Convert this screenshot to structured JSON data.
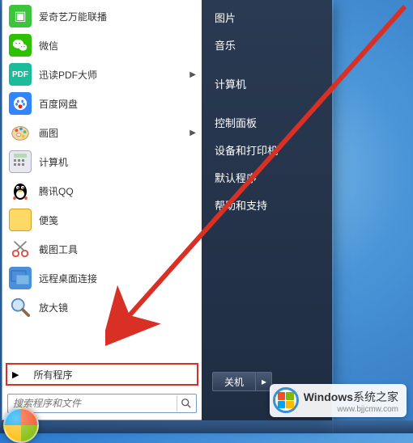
{
  "programs": [
    {
      "label": "爱奇艺万能联播",
      "icon": "iqiyi",
      "has_submenu": false
    },
    {
      "label": "微信",
      "icon": "wechat",
      "has_submenu": false
    },
    {
      "label": "迅读PDF大师",
      "icon": "pdf",
      "has_submenu": true
    },
    {
      "label": "百度网盘",
      "icon": "baidu",
      "has_submenu": false
    },
    {
      "label": "画图",
      "icon": "paint",
      "has_submenu": true
    },
    {
      "label": "计算机",
      "icon": "calc",
      "has_submenu": false
    },
    {
      "label": "腾讯QQ",
      "icon": "qq",
      "has_submenu": false
    },
    {
      "label": "便笺",
      "icon": "note",
      "has_submenu": false
    },
    {
      "label": "截图工具",
      "icon": "snip",
      "has_submenu": false
    },
    {
      "label": "远程桌面连接",
      "icon": "rdp",
      "has_submenu": false
    },
    {
      "label": "放大镜",
      "icon": "mag",
      "has_submenu": false
    }
  ],
  "all_programs_label": "所有程序",
  "search_placeholder": "搜索程序和文件",
  "right_items": [
    "图片",
    "音乐",
    "计算机",
    "控制面板",
    "设备和打印机",
    "默认程序",
    "帮助和支持"
  ],
  "shutdown_label": "关机",
  "watermark": {
    "title_prefix": "Windows",
    "title_suffix": "系统之家",
    "url": "www.bjjcmw.com"
  },
  "colors": {
    "highlight_border": "#d93025",
    "right_panel_bg": "#1f2d42"
  }
}
